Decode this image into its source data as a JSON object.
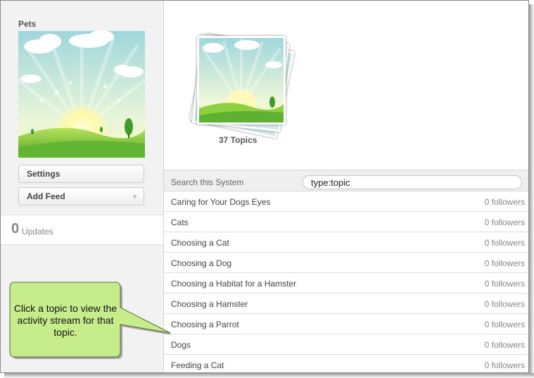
{
  "sidebar": {
    "system_name": "Pets",
    "settings_label": "Settings",
    "add_feed_label": "Add Feed",
    "add_feed_plus": "+",
    "updates_count": "0",
    "updates_label": "Updates"
  },
  "topics_summary": {
    "count_label": "37 Topics"
  },
  "search": {
    "label": "Search this System",
    "value": "type:topic"
  },
  "topics": [
    {
      "name": "Caring for Your Dogs Eyes",
      "followers": "0 followers"
    },
    {
      "name": "Cats",
      "followers": "0 followers"
    },
    {
      "name": "Choosing a Cat",
      "followers": "0 followers"
    },
    {
      "name": "Choosing a Dog",
      "followers": "0 followers"
    },
    {
      "name": "Choosing a Habitat for a Hamster",
      "followers": "0 followers"
    },
    {
      "name": "Choosing a Hamster",
      "followers": "0 followers"
    },
    {
      "name": "Choosing a Parrot",
      "followers": "0 followers"
    },
    {
      "name": "Dogs",
      "followers": "0 followers"
    },
    {
      "name": "Feeding a Cat",
      "followers": "0 followers"
    }
  ],
  "callout": {
    "text": "Click a topic to view the activity stream for that topic."
  },
  "colors": {
    "callout_fill": "#c6ec8c",
    "callout_border": "#5a6d3a",
    "sky": "#bfe6ea",
    "grass": "#7cc23a"
  },
  "icons": {
    "system_image": "spring-landscape-image",
    "topics_stack": "stacked-images-icon"
  }
}
